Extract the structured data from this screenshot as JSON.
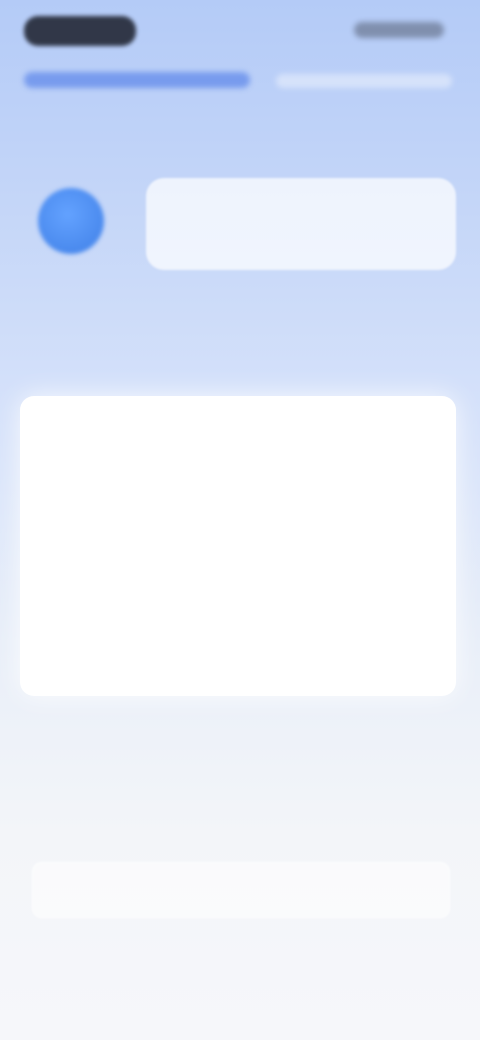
{
  "greeting": {
    "text": ""
  },
  "intro": {
    "text": ""
  },
  "card": {
    "title": "",
    "options": [
      "",
      "",
      ""
    ]
  },
  "description": {
    "text": ""
  },
  "actions": {
    "primary_label": "",
    "secondary_label": ""
  }
}
